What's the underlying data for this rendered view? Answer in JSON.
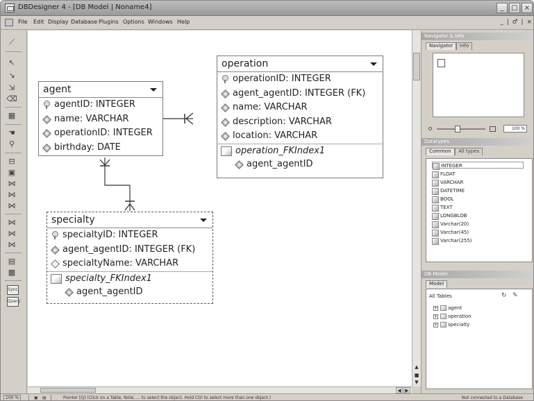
{
  "window": {
    "title": "DBDesigner 4 - [DB Model | Noname4]",
    "controls": [
      "_",
      "□",
      "×"
    ]
  },
  "menu": {
    "items": [
      "File",
      "Edit",
      "Display",
      "Database",
      "Plugins",
      "Options",
      "Windows",
      "Help"
    ],
    "mdi_controls": "_ | ♂ | ×"
  },
  "toolbar": {
    "icons": [
      "wand-icon",
      "pointer-icon",
      "move-icon",
      "sub-pointer-icon",
      "eraser-icon",
      "grid-icon",
      "hand-icon",
      "zoom-icon",
      "table-icon",
      "view-icon",
      "relation-1n-icon",
      "relation-11-icon",
      "relation-nm-icon",
      "relation-1n-sub-icon",
      "relation-11-sub-icon",
      "relation-nm-sub-icon",
      "note-icon",
      "image-icon"
    ],
    "sync_label": "Sync",
    "query_label": "Query"
  },
  "entities": {
    "agent": {
      "name": "agent",
      "fields": [
        {
          "text": "agentID: INTEGER",
          "icon": "primary-key-icon"
        },
        {
          "text": "name: VARCHAR",
          "icon": "column-icon"
        },
        {
          "text": "operationID: INTEGER",
          "icon": "column-icon"
        },
        {
          "text": "birthday: DATE",
          "icon": "column-icon"
        }
      ]
    },
    "operation": {
      "name": "operation",
      "fields": [
        {
          "text": "operationID: INTEGER",
          "icon": "primary-key-icon"
        },
        {
          "text": "agent_agentID: INTEGER (FK)",
          "icon": "column-icon"
        },
        {
          "text": "name: VARCHAR",
          "icon": "column-icon"
        },
        {
          "text": "description: VARCHAR",
          "icon": "column-icon"
        },
        {
          "text": "location: VARCHAR",
          "icon": "column-icon"
        }
      ],
      "index_name": "operation_FKIndex1",
      "index_field": "agent_agentID"
    },
    "specialty": {
      "name": "specialty",
      "fields": [
        {
          "text": "specialtyID: INTEGER",
          "icon": "primary-key-icon"
        },
        {
          "text": "agent_agentID: INTEGER (FK)",
          "icon": "column-icon"
        },
        {
          "text": "specialtyName: VARCHAR",
          "icon": "column-icon"
        }
      ],
      "index_name": "specialty_FKIndex1",
      "index_field": "agent_agentID"
    }
  },
  "navigator": {
    "title": "Navigator & Info",
    "tabs": [
      "Navigator",
      "Info"
    ],
    "zoom": "100 %"
  },
  "datatypes": {
    "title": "Datatypes",
    "tabs": [
      "Common",
      "All types"
    ],
    "items": [
      "INTEGER",
      "FLOAT",
      "VARCHAR",
      "DATETIME",
      "BOOL",
      "TEXT",
      "LONGBLOB",
      "Varchar(20)",
      "Varchar(45)",
      "Varchar(255)"
    ]
  },
  "db_model": {
    "title": "DB Model",
    "tabs": [
      "Model"
    ],
    "tree_root": "All Tables",
    "tables": [
      "agent",
      "operation",
      "specialty"
    ]
  },
  "statusbar": {
    "zoom": "100 %",
    "hint": "Pointer [Q] (Click on a Table, Note, ... to select the object. Hold Ctrl to select more than one object.)",
    "connection": "Not connected to a Database"
  }
}
